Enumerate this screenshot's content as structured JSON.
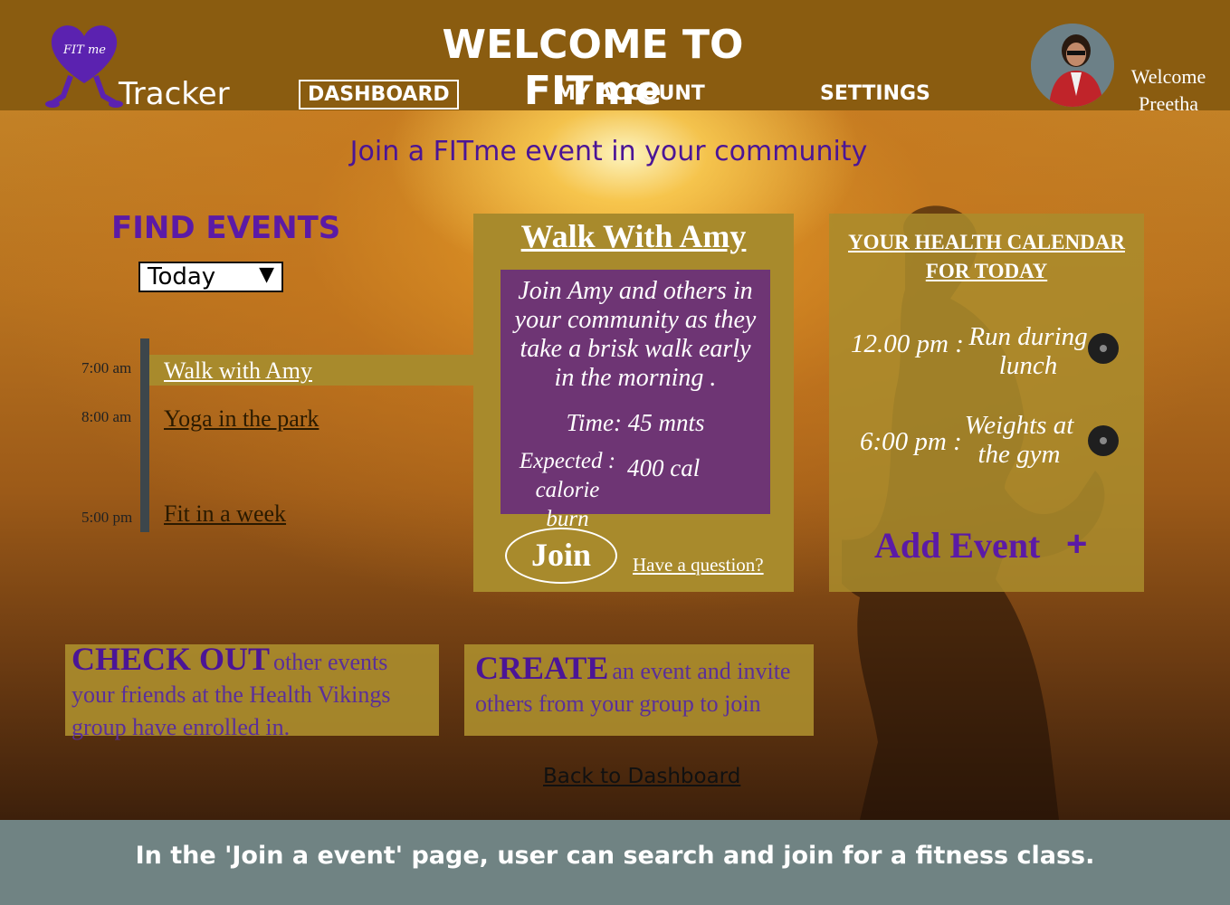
{
  "app": {
    "title": "WELCOME TO FITme",
    "logo_text": "FIT me",
    "tracker_label": "Tracker"
  },
  "nav": {
    "dashboard": "DASHBOARD",
    "my_account": "MY ACCOUNT",
    "settings": "SETTINGS"
  },
  "user": {
    "welcome": "Welcome",
    "name": "Preetha"
  },
  "subtitle": "Join a FITme event in your community",
  "find_events": {
    "title": "FIND EVENTS",
    "filter_value": "Today",
    "events": [
      {
        "time": "7:00 am",
        "name": "Walk with Amy"
      },
      {
        "time": "8:00 am",
        "name": "Yoga in the park"
      },
      {
        "time": "5:00 pm",
        "name": "Fit in a week"
      }
    ]
  },
  "event_card": {
    "title": "Walk With Amy",
    "description": "Join Amy and others in your community as they take a brisk walk early in the morning .",
    "duration": "Time: 45 mnts",
    "calorie_label": "Expected : calorie burn",
    "calorie_value": "400 cal",
    "join_label": "Join",
    "question_label": "Have a question?"
  },
  "health_calendar": {
    "title_line1": "YOUR HEALTH CALENDAR",
    "title_line2": "FOR TODAY",
    "slots": [
      {
        "time": "12.00 pm :",
        "activity": "Run during lunch"
      },
      {
        "time": "6:00 pm :",
        "activity": "Weights at the gym"
      }
    ],
    "add_label": "Add Event",
    "add_icon": "+"
  },
  "promos": {
    "check_out_big": "CHECK OUT",
    "check_out_rest": "other events your friends at the Health Vikings group have enrolled in.",
    "create_big": "CREATE",
    "create_rest": "an event and invite others from your group to join"
  },
  "back_link": "Back to Dashboard",
  "footer": "In the 'Join a event' page, user can search and join for a fitness class."
}
